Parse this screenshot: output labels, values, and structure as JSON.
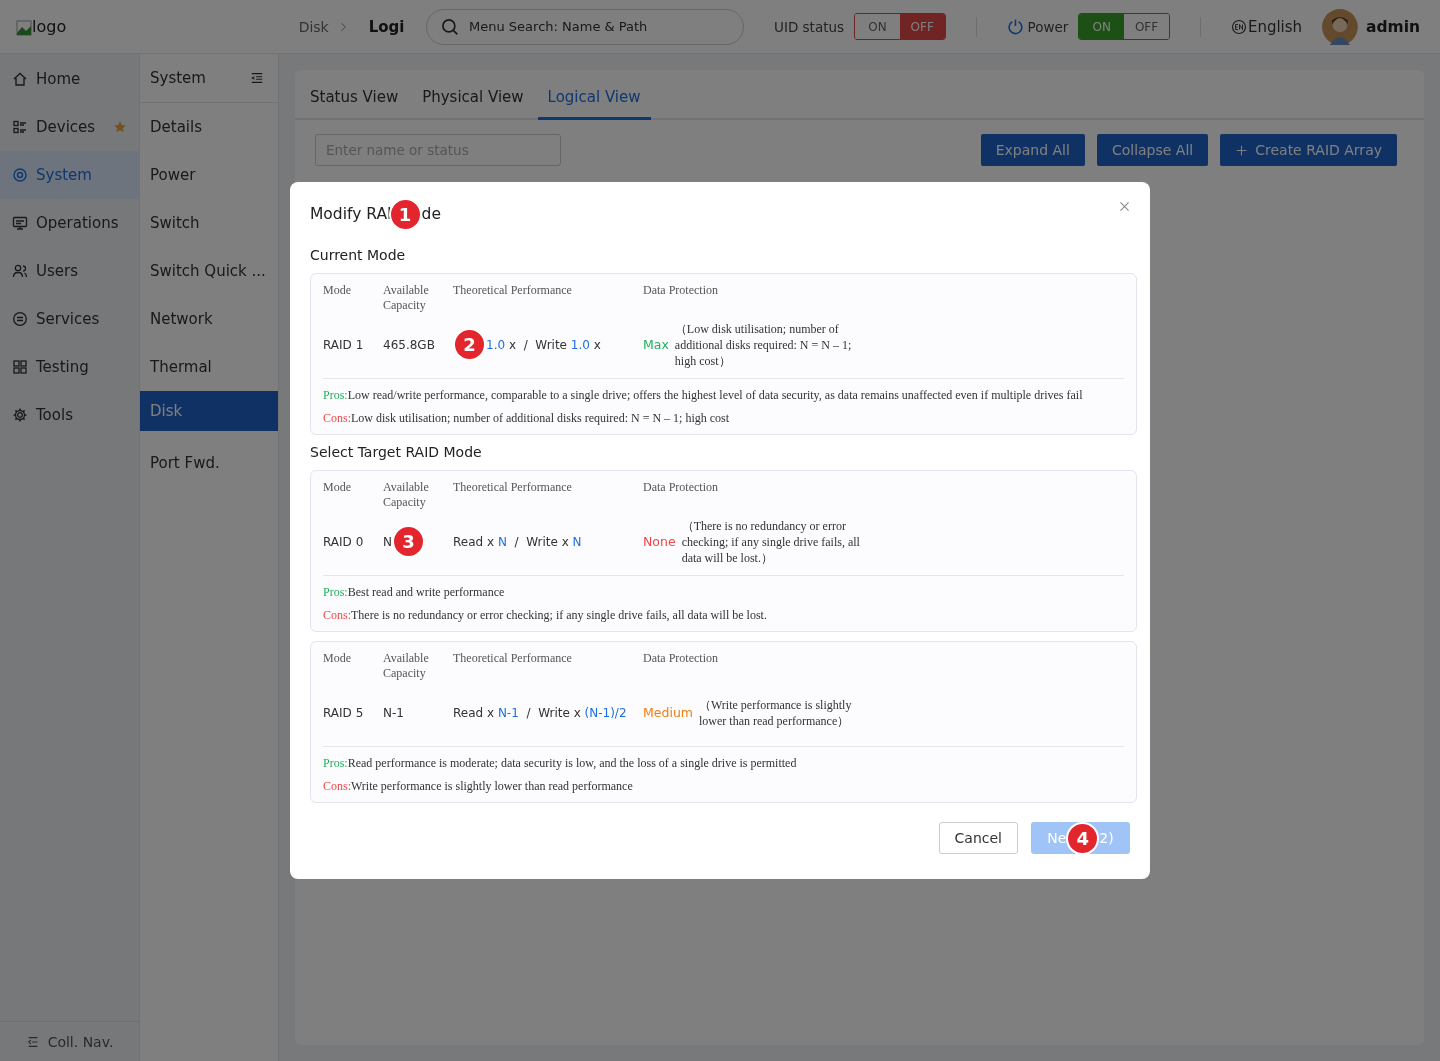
{
  "header": {
    "logo": "logo",
    "breadcrumb": [
      {
        "label": "Disk"
      },
      {
        "label": "Logi"
      }
    ],
    "search": {
      "placeholder": "Menu Search: Name & Path"
    },
    "uid_status": {
      "label": "UID status",
      "options": [
        {
          "label": "ON",
          "selected": false
        },
        {
          "label": "OFF",
          "selected": true
        }
      ]
    },
    "power": {
      "label": "Power",
      "options": [
        {
          "label": "ON",
          "selected": true
        },
        {
          "label": "OFF",
          "selected": false
        }
      ]
    },
    "language": "English",
    "user": "admin"
  },
  "nav": {
    "items": [
      {
        "label": "Home",
        "selected": false,
        "starred": false
      },
      {
        "label": "Devices",
        "selected": false,
        "starred": true
      },
      {
        "label": "System",
        "selected": true,
        "starred": false
      },
      {
        "label": "Operations",
        "selected": false,
        "starred": false
      },
      {
        "label": "Users",
        "selected": false,
        "starred": false
      },
      {
        "label": "Services",
        "selected": false,
        "starred": false
      },
      {
        "label": "Testing",
        "selected": false,
        "starred": false
      },
      {
        "label": "Tools",
        "selected": false,
        "starred": false
      }
    ],
    "collapse": "Coll. Nav."
  },
  "subnav": {
    "title": "System",
    "items": [
      {
        "label": "Details",
        "selected": false
      },
      {
        "label": "Power",
        "selected": false
      },
      {
        "label": "Switch",
        "selected": false
      },
      {
        "label": "Switch Quick ...",
        "selected": false
      },
      {
        "label": "Network",
        "selected": false
      },
      {
        "label": "Thermal",
        "selected": false
      },
      {
        "label": "Disk",
        "selected": true
      },
      {
        "label": "Port Fwd.",
        "selected": false
      }
    ]
  },
  "tabs": [
    {
      "label": "Status View",
      "selected": false
    },
    {
      "label": "Physical View",
      "selected": false
    },
    {
      "label": "Logical View",
      "selected": true
    }
  ],
  "filter": {
    "placeholder": "Enter name or status"
  },
  "actions": [
    {
      "label": "Expand All"
    },
    {
      "label": "Collapse All"
    },
    {
      "label": "Create RAID Array"
    }
  ],
  "dialog": {
    "title": [
      {
        "kind": "text",
        "text": "Modify RAI"
      },
      {
        "kind": "marker",
        "text": "1"
      },
      {
        "kind": "text",
        "text": "de"
      }
    ],
    "sections": [
      {
        "heading": "Current Mode",
        "modes": [
          {
            "columns": [
              "Mode",
              "Available Capacity",
              "Theoretical Performance",
              "Data Protection"
            ],
            "mode": "RAID 1",
            "capacity": "465.8GB",
            "performance": [
              {
                "kind": "marker",
                "text": "2"
              },
              {
                "kind": "value",
                "text": "1.0"
              },
              {
                "kind": "plain",
                "text": " x  /  Write "
              },
              {
                "kind": "value",
                "text": "1.0"
              },
              {
                "kind": "plain",
                "text": " x"
              }
            ],
            "protection": "Max",
            "color": "#1fb15a",
            "protection_note": "（Low disk utilisation; number of additional disks required: N = N – 1; high cost）",
            "pros_label": "Pros:",
            "pros": "Low read/write performance, comparable to a single drive; offers the highest level of data security, as data remains unaffected even if multiple drives fail",
            "cons_label": "Cons:",
            "cons": "Low disk utilisation; number of additional disks required: N = N – 1; high cost"
          }
        ]
      },
      {
        "heading": "Select Target RAID Mode",
        "modes": [
          {
            "columns": [
              "Mode",
              "Available Capacity",
              "Theoretical Performance",
              "Data Protection"
            ],
            "mode": "RAID 0",
            "capacity": "N",
            "capacity_marker": "3",
            "performance": [
              {
                "kind": "plain",
                "text": "Read x "
              },
              {
                "kind": "value",
                "text": "N"
              },
              {
                "kind": "plain",
                "text": "  /  Write x "
              },
              {
                "kind": "value",
                "text": "N"
              }
            ],
            "protection": "None",
            "color": "#f04848",
            "protection_note": "（There is no redundancy or error checking; if any single drive fails, all data will be lost.）",
            "pros_label": "Pros:",
            "pros": "Best read and write performance",
            "cons_label": "Cons:",
            "cons": "There is no redundancy or error checking; if any single drive fails, all data will be lost."
          },
          {
            "columns": [
              "Mode",
              "Available Capacity",
              "Theoretical Performance",
              "Data Protection"
            ],
            "mode": "RAID 5",
            "capacity": "N-1",
            "performance": [
              {
                "kind": "plain",
                "text": "Read x "
              },
              {
                "kind": "value",
                "text": "N-1"
              },
              {
                "kind": "plain",
                "text": "  /  Write x "
              },
              {
                "kind": "value",
                "text": "(N-1)/2"
              }
            ],
            "protection": "Medium",
            "color": "#f07f10",
            "protection_note": "（Write performance is slightly lower than read performance）",
            "pros_label": "Pros:",
            "pros": "Read performance is moderate; data security is low, and the loss of a single drive is permitted",
            "cons_label": "Cons:",
            "cons": "Write performance is slightly lower than read performance"
          }
        ]
      }
    ],
    "buttons": [
      {
        "kind": "secondary",
        "disabled": false,
        "label": [
          {
            "kind": "text",
            "text": "Cancel"
          }
        ]
      },
      {
        "kind": "primary",
        "disabled": true,
        "label": [
          {
            "kind": "text",
            "text": "Ne"
          },
          {
            "kind": "marker",
            "text": "4"
          },
          {
            "kind": "text",
            "text": "2)"
          }
        ]
      }
    ]
  }
}
